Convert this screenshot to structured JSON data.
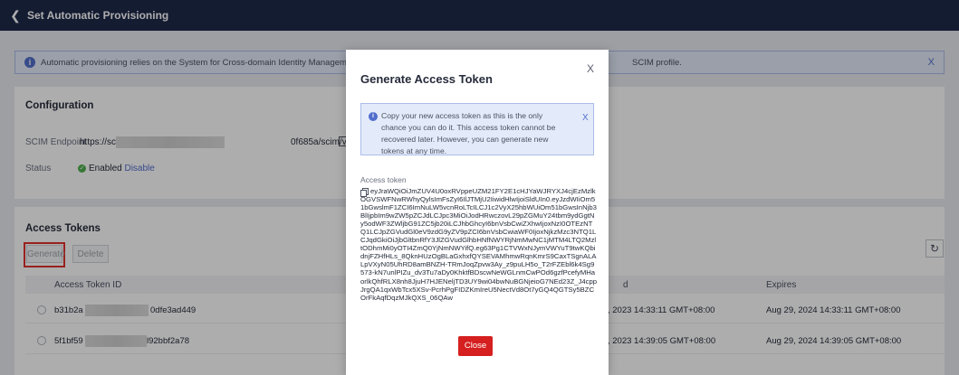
{
  "header": {
    "title": "Set Automatic Provisioning",
    "back_icon": "chevron-left-icon"
  },
  "info_banner": {
    "text": "Automatic provisioning relies on the System for Cross-domain Identity Management (SCIM) protocol to provision u",
    "text_tail": "SCIM profile.",
    "close": "X"
  },
  "configuration": {
    "title": "Configuration",
    "endpoint_label": "SCIM Endpoint",
    "endpoint_prefix": "https://scim.",
    "endpoint_suffix": "0f685a/scim/v2/",
    "status_label": "Status",
    "status_value": "Enabled",
    "status_action": "Disable"
  },
  "access_tokens": {
    "title": "Access Tokens",
    "generate_label": "Generate",
    "delete_label": "Delete",
    "refresh_icon": "refresh-icon",
    "columns": [
      "Access Token ID",
      "d",
      "Expires"
    ],
    "rows": [
      {
        "id_prefix": "b31b2a",
        "id_suffix": "0dfe3ad449",
        "created": ", 2023 14:33:11 GMT+08:00",
        "expires": "Aug 29, 2024 14:33:11 GMT+08:00"
      },
      {
        "id_prefix": "5f1bf59",
        "id_suffix": "l92bbf2a78",
        "created": ", 2023 14:39:05 GMT+08:00",
        "expires": "Aug 29, 2024 14:39:05 GMT+08:00"
      }
    ]
  },
  "modal": {
    "title": "Generate Access Token",
    "close": "X",
    "notice": "Copy your new access token as this is the only chance you can do it. This access token cannot be recovered later. However, you can generate new tokens at any time.",
    "notice_close": "X",
    "token_label": "Access token",
    "token": "eyJraWQiOiJmZUV4U0oxRVppeUZM21FY2E1cHJYaWJRYXJ4cjEzMzlkOGVSWFNwRWhyQylsImFsZyI6IlJTMjU2IiwidHlwIjoiSldUIn0.eyJzdWIiOm51bGwslmF1ZCI6ImNuLW5vcnRoLTcILCJ1c2VyX25hbWUiOm51bGwsInNjb3BlIjpbIm9wZW5pZCJdLCJpc3MiOiJodHRwczovL29pZGMuY24tbm9ydGgtNy5odWF3ZWljbG91ZC5jb20iLCJhbGhcyI6bnVsbCwiZXhwIjoxNzI0OTEzNTQ1LCJpZGVudGl0eV9zdG9yZV9pZCI6bnVsbCwiaWF0IjoxNjkzMzc3NTQ1LCJqdGkiOiJjbGltbnRfY3JlZGVudGlhbHNfNWYRjNmMwNC1jMTM4LTQ2MzltODhmMi0yOTI4ZmQ0YjNmNWYifQ.eg63Pg1CTVWxNJymVWYuT9twKQbidnjFZHfHLs_8QknHUzOgBLaGxhxfQYSEVAMhmwRqnKmrS9CaxTSgnALALpVXyN05UhRD8amBNZH-TRmJoqZpvw3Ay_z9puLH5o_T2rFZEbl6k4Sg9573-kN7unlPIZu_dv3Tu7aDy0KhktfBDscwNeWGLnmCwPOd6gzfPcefyMHaorlkQhfRLX8nh8JjuH7HJENeljTD3UY9wi04bwNuBGNjeioG7NEd23Z_J4cppJrgQA1qxWbTcx5XSv-PcrhPgFIDZKmIreU5NectVd8Ot7yGQ4QGTSy5BZCOrFkAqfDqzMJkQXS_06QAw",
    "close_button": "Close",
    "copy_icon": "copy-icon"
  }
}
